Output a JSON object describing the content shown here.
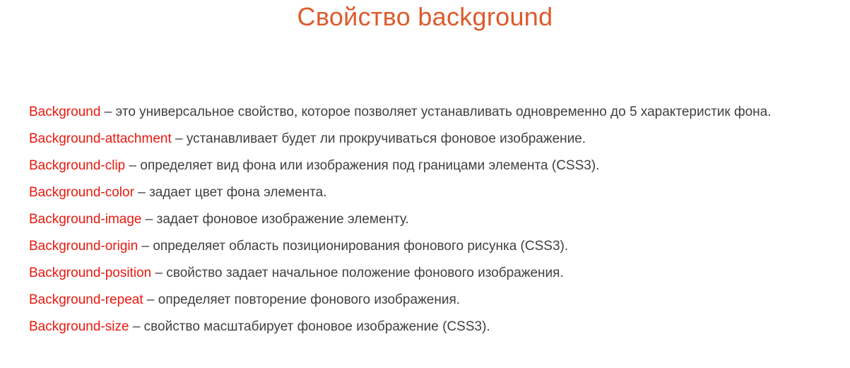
{
  "colors": {
    "title": "#dd5b2d",
    "term": "#e8190f",
    "text": "#404040",
    "background": "#ffffff"
  },
  "slide": {
    "title": "Свойство background",
    "items": [
      {
        "term": "Background",
        "separator": "–",
        "description": "это универсальное свойство, которое позволяет устанавливать одновременно до 5 характеристик фона."
      },
      {
        "term": "Background-attachment",
        "separator": "–",
        "description": "устанавливает будет ли прокручиваться фоновое изображение."
      },
      {
        "term": "Background-clip",
        "separator": "–",
        "description": "определяет вид фона или изображения под границами элемента (CSS3)."
      },
      {
        "term": "Background-color",
        "separator": "–",
        "description": "задает цвет фона элемента."
      },
      {
        "term": "Background-image",
        "separator": "–",
        "description": "задает фоновое изображение элементу."
      },
      {
        "term": "Background-origin",
        "separator": "–",
        "description": "определяет область позиционирования фонового рисунка (CSS3)."
      },
      {
        "term": "Background-position",
        "separator": "–",
        "description": "свойство задает начальное положение фонового изображения."
      },
      {
        "term": "Background-repeat",
        "separator": "–",
        "description": "определяет повторение фонового изображения."
      },
      {
        "term": "Background-size",
        "separator": "–",
        "description": "свойство масштабирует фоновое изображение (CSS3)."
      }
    ]
  }
}
